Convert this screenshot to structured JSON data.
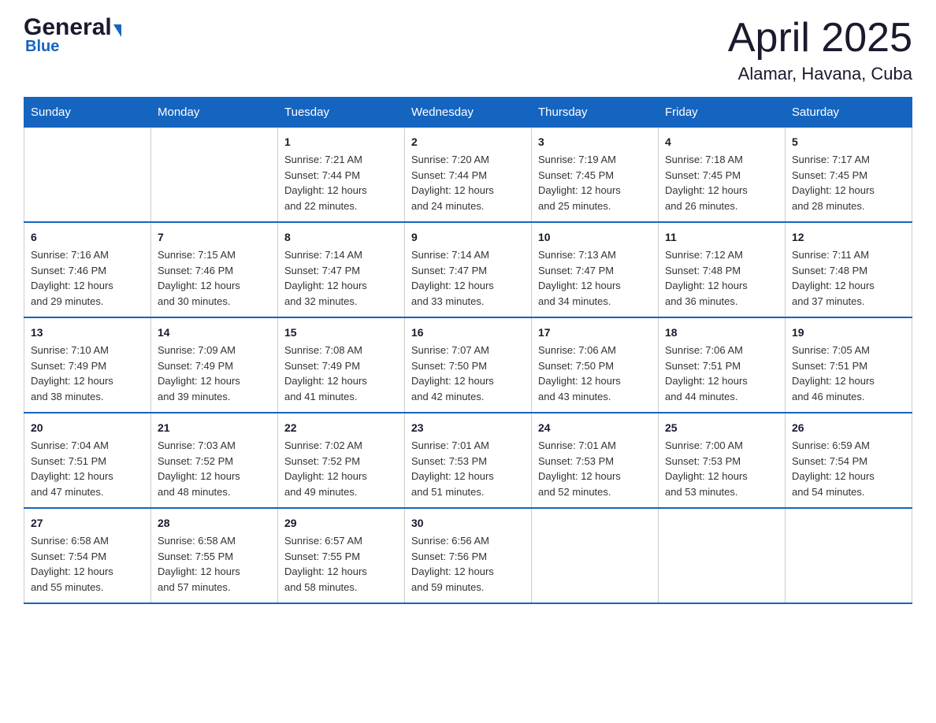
{
  "logo": {
    "general": "General",
    "blue": "Blue"
  },
  "title": "April 2025",
  "subtitle": "Alamar, Havana, Cuba",
  "days_of_week": [
    "Sunday",
    "Monday",
    "Tuesday",
    "Wednesday",
    "Thursday",
    "Friday",
    "Saturday"
  ],
  "weeks": [
    [
      {
        "num": "",
        "info": ""
      },
      {
        "num": "",
        "info": ""
      },
      {
        "num": "1",
        "info": "Sunrise: 7:21 AM\nSunset: 7:44 PM\nDaylight: 12 hours\nand 22 minutes."
      },
      {
        "num": "2",
        "info": "Sunrise: 7:20 AM\nSunset: 7:44 PM\nDaylight: 12 hours\nand 24 minutes."
      },
      {
        "num": "3",
        "info": "Sunrise: 7:19 AM\nSunset: 7:45 PM\nDaylight: 12 hours\nand 25 minutes."
      },
      {
        "num": "4",
        "info": "Sunrise: 7:18 AM\nSunset: 7:45 PM\nDaylight: 12 hours\nand 26 minutes."
      },
      {
        "num": "5",
        "info": "Sunrise: 7:17 AM\nSunset: 7:45 PM\nDaylight: 12 hours\nand 28 minutes."
      }
    ],
    [
      {
        "num": "6",
        "info": "Sunrise: 7:16 AM\nSunset: 7:46 PM\nDaylight: 12 hours\nand 29 minutes."
      },
      {
        "num": "7",
        "info": "Sunrise: 7:15 AM\nSunset: 7:46 PM\nDaylight: 12 hours\nand 30 minutes."
      },
      {
        "num": "8",
        "info": "Sunrise: 7:14 AM\nSunset: 7:47 PM\nDaylight: 12 hours\nand 32 minutes."
      },
      {
        "num": "9",
        "info": "Sunrise: 7:14 AM\nSunset: 7:47 PM\nDaylight: 12 hours\nand 33 minutes."
      },
      {
        "num": "10",
        "info": "Sunrise: 7:13 AM\nSunset: 7:47 PM\nDaylight: 12 hours\nand 34 minutes."
      },
      {
        "num": "11",
        "info": "Sunrise: 7:12 AM\nSunset: 7:48 PM\nDaylight: 12 hours\nand 36 minutes."
      },
      {
        "num": "12",
        "info": "Sunrise: 7:11 AM\nSunset: 7:48 PM\nDaylight: 12 hours\nand 37 minutes."
      }
    ],
    [
      {
        "num": "13",
        "info": "Sunrise: 7:10 AM\nSunset: 7:49 PM\nDaylight: 12 hours\nand 38 minutes."
      },
      {
        "num": "14",
        "info": "Sunrise: 7:09 AM\nSunset: 7:49 PM\nDaylight: 12 hours\nand 39 minutes."
      },
      {
        "num": "15",
        "info": "Sunrise: 7:08 AM\nSunset: 7:49 PM\nDaylight: 12 hours\nand 41 minutes."
      },
      {
        "num": "16",
        "info": "Sunrise: 7:07 AM\nSunset: 7:50 PM\nDaylight: 12 hours\nand 42 minutes."
      },
      {
        "num": "17",
        "info": "Sunrise: 7:06 AM\nSunset: 7:50 PM\nDaylight: 12 hours\nand 43 minutes."
      },
      {
        "num": "18",
        "info": "Sunrise: 7:06 AM\nSunset: 7:51 PM\nDaylight: 12 hours\nand 44 minutes."
      },
      {
        "num": "19",
        "info": "Sunrise: 7:05 AM\nSunset: 7:51 PM\nDaylight: 12 hours\nand 46 minutes."
      }
    ],
    [
      {
        "num": "20",
        "info": "Sunrise: 7:04 AM\nSunset: 7:51 PM\nDaylight: 12 hours\nand 47 minutes."
      },
      {
        "num": "21",
        "info": "Sunrise: 7:03 AM\nSunset: 7:52 PM\nDaylight: 12 hours\nand 48 minutes."
      },
      {
        "num": "22",
        "info": "Sunrise: 7:02 AM\nSunset: 7:52 PM\nDaylight: 12 hours\nand 49 minutes."
      },
      {
        "num": "23",
        "info": "Sunrise: 7:01 AM\nSunset: 7:53 PM\nDaylight: 12 hours\nand 51 minutes."
      },
      {
        "num": "24",
        "info": "Sunrise: 7:01 AM\nSunset: 7:53 PM\nDaylight: 12 hours\nand 52 minutes."
      },
      {
        "num": "25",
        "info": "Sunrise: 7:00 AM\nSunset: 7:53 PM\nDaylight: 12 hours\nand 53 minutes."
      },
      {
        "num": "26",
        "info": "Sunrise: 6:59 AM\nSunset: 7:54 PM\nDaylight: 12 hours\nand 54 minutes."
      }
    ],
    [
      {
        "num": "27",
        "info": "Sunrise: 6:58 AM\nSunset: 7:54 PM\nDaylight: 12 hours\nand 55 minutes."
      },
      {
        "num": "28",
        "info": "Sunrise: 6:58 AM\nSunset: 7:55 PM\nDaylight: 12 hours\nand 57 minutes."
      },
      {
        "num": "29",
        "info": "Sunrise: 6:57 AM\nSunset: 7:55 PM\nDaylight: 12 hours\nand 58 minutes."
      },
      {
        "num": "30",
        "info": "Sunrise: 6:56 AM\nSunset: 7:56 PM\nDaylight: 12 hours\nand 59 minutes."
      },
      {
        "num": "",
        "info": ""
      },
      {
        "num": "",
        "info": ""
      },
      {
        "num": "",
        "info": ""
      }
    ]
  ]
}
